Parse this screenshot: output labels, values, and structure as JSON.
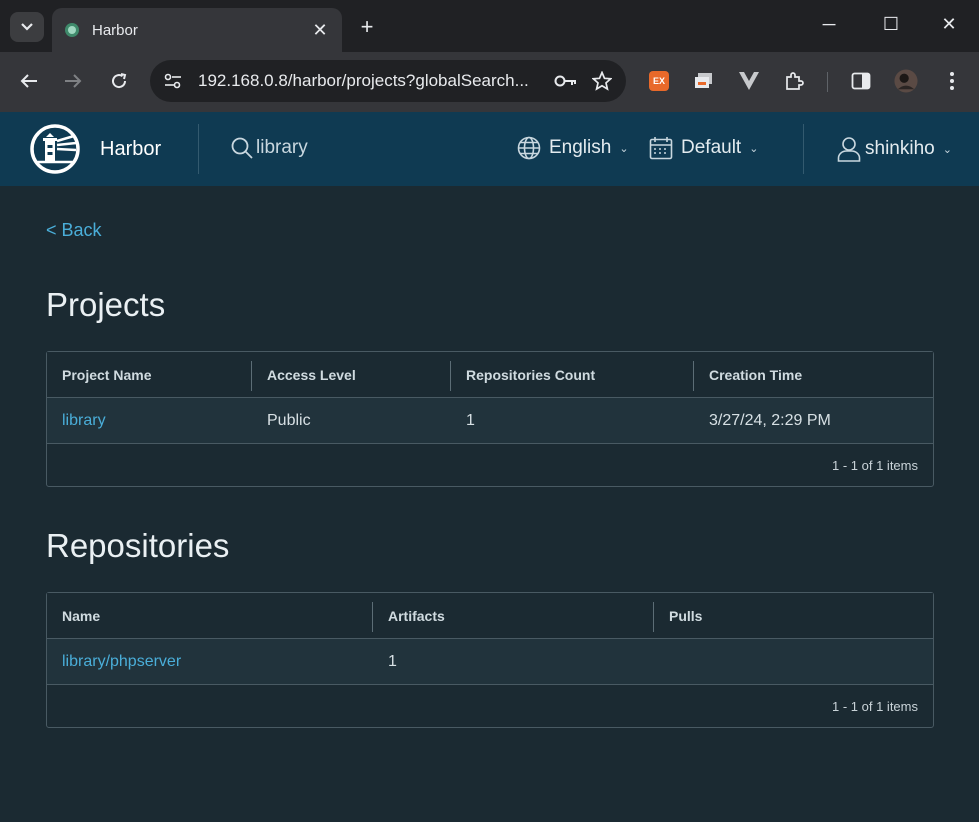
{
  "browser": {
    "tab_title": "Harbor",
    "url": "192.168.0.8/harbor/projects?globalSearch...",
    "extension_badge": "EX"
  },
  "header": {
    "brand": "Harbor",
    "search_value": "library",
    "language": "English",
    "theme": "Default",
    "user": "shinkiho"
  },
  "page": {
    "back_label": "< Back",
    "projects_title": "Projects",
    "repositories_title": "Repositories"
  },
  "projects": {
    "columns": [
      "Project Name",
      "Access Level",
      "Repositories Count",
      "Creation Time"
    ],
    "rows": [
      {
        "name": "library",
        "access": "Public",
        "repo_count": "1",
        "created": "3/27/24, 2:29 PM"
      }
    ],
    "footer": "1 - 1 of 1 items"
  },
  "repositories": {
    "columns": [
      "Name",
      "Artifacts",
      "Pulls"
    ],
    "rows": [
      {
        "name": "library/phpserver",
        "artifacts": "1",
        "pulls": ""
      }
    ],
    "footer": "1 - 1 of 1 items"
  },
  "colors": {
    "header_bg": "#0f3a52",
    "content_bg": "#1b2a32",
    "link": "#4aaed9"
  }
}
